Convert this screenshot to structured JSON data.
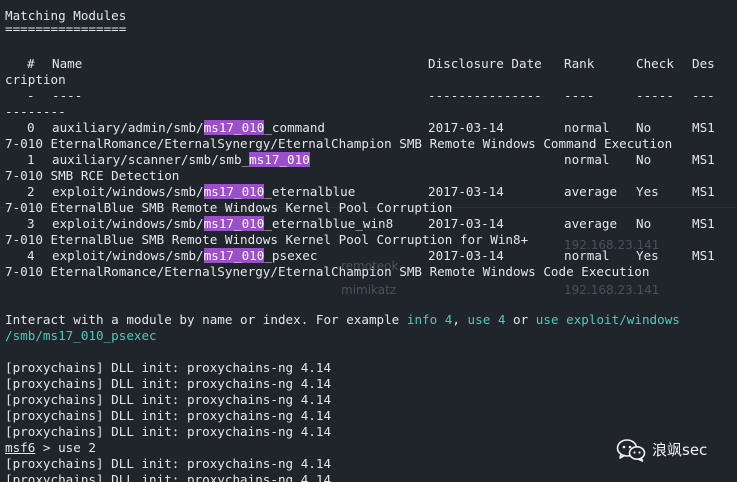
{
  "section_title": "Matching Modules",
  "section_underline": "================",
  "table": {
    "header": {
      "num": "#",
      "name": "Name",
      "disclosure_date": "Disclosure Date",
      "rank": "Rank",
      "check": "Check",
      "description_a": "Des",
      "description_b": "cription"
    },
    "separators": {
      "num": "-",
      "name": "----",
      "disclosure_date": "---------------",
      "rank": "----",
      "check": "-----",
      "description_a": "---",
      "description_b": "--------"
    },
    "rows": [
      {
        "num": "0",
        "name_pre": "auxiliary/admin/smb/",
        "name_hl": "ms17_010",
        "name_post": "_command",
        "date": "2017-03-14",
        "rank": "normal",
        "check": "No",
        "desc_a": "MS1",
        "desc_b": "7-010 EternalRomance/EternalSynergy/EternalChampion SMB Remote Windows Command Execution"
      },
      {
        "num": "1",
        "name_pre": "auxiliary/scanner/smb/smb_",
        "name_hl": "ms17_010",
        "name_post": "",
        "date": "",
        "rank": "normal",
        "check": "No",
        "desc_a": "MS1",
        "desc_b": "7-010 SMB RCE Detection"
      },
      {
        "num": "2",
        "name_pre": "exploit/windows/smb/",
        "name_hl": "ms17_010",
        "name_post": "_eternalblue",
        "date": "2017-03-14",
        "rank": "average",
        "check": "Yes",
        "desc_a": "MS1",
        "desc_b": "7-010 EternalBlue SMB Remote Windows Kernel Pool Corruption"
      },
      {
        "num": "3",
        "name_pre": "exploit/windows/smb/",
        "name_hl": "ms17_010",
        "name_post": "_eternalblue_win8",
        "date": "2017-03-14",
        "rank": "average",
        "check": "No",
        "desc_a": "MS1",
        "desc_b": "7-010 EternalBlue SMB Remote Windows Kernel Pool Corruption for Win8+"
      },
      {
        "num": "4",
        "name_pre": "exploit/windows/smb/",
        "name_hl": "ms17_010",
        "name_post": "_psexec",
        "date": "2017-03-14",
        "rank": "normal",
        "check": "Yes",
        "desc_a": "MS1",
        "desc_b": "7-010 EternalRomance/EternalSynergy/EternalChampion SMB Remote Windows Code Execution"
      }
    ]
  },
  "interact": {
    "prefix": "Interact with a module by name or index. For example ",
    "cmd_info": "info 4",
    "sep1": ", ",
    "cmd_use": "use 4",
    "sep2": " or ",
    "cmd_use_path_a": "use exploit/windows",
    "cmd_use_path_b": "/smb/ms17_010_psexec"
  },
  "proxy_line": "[proxychains] DLL init: proxychains-ng 4.14",
  "prompt": {
    "name": "msf6",
    "arrow": " > ",
    "command": "use 2"
  },
  "background_ghost": {
    "ip_1": "192.168.23.141",
    "ip_2": "192.168.23.141",
    "tool": "mimikatz",
    "label": "remoteok"
  },
  "watermark": {
    "text": "浪飒sec",
    "icon": "wechat-icon"
  },
  "colors": {
    "background": "#20242b",
    "foreground": "#e4e6ea",
    "highlight": "#9b4fc9",
    "link_cyan": "#4fc9c1"
  }
}
